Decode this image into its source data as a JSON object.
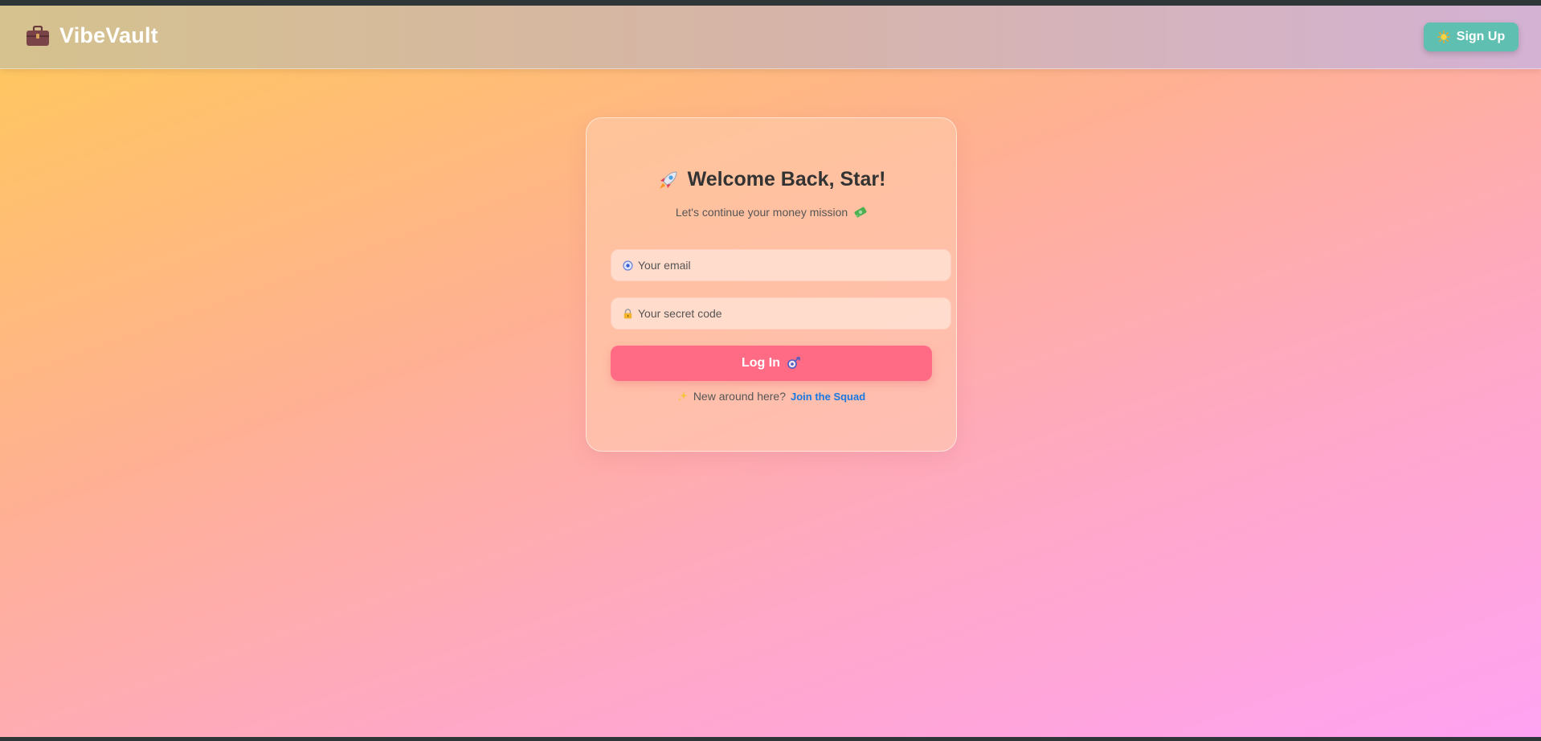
{
  "navbar": {
    "brand": "VibeVault",
    "brand_icon": "briefcase-icon",
    "signup_label": "Sign Up",
    "signup_icon": "sun-icon"
  },
  "login_card": {
    "title": "Welcome Back, Star!",
    "title_icon": "rocket-icon",
    "subtitle": "Let's continue your money mission",
    "subtitle_icon": "money-icon",
    "email": {
      "placeholder": "Your email",
      "value": "",
      "icon": "email-icon"
    },
    "secret_code": {
      "placeholder": "Your secret code",
      "value": "",
      "icon": "lock-icon"
    },
    "login_label": "Log In",
    "login_icon": "key-icon",
    "footer_text": "New around here?",
    "footer_icon": "sparkle-icon",
    "join_link": "Join the Squad"
  },
  "colors": {
    "accent_teal": "#5fbfb1",
    "login_pink": "#ff6b85",
    "link_blue": "#1a78e0"
  }
}
